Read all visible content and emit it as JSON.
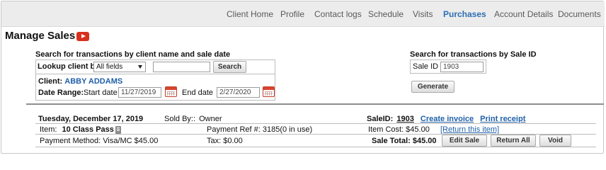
{
  "nav": {
    "items": [
      {
        "label": "Client Home",
        "active": false
      },
      {
        "label": "Profile",
        "active": false
      },
      {
        "label": "Contact logs",
        "active": false
      },
      {
        "label": "Schedule",
        "active": false
      },
      {
        "label": "Visits",
        "active": false
      },
      {
        "label": "Purchases",
        "active": true
      },
      {
        "label": "Account Details",
        "active": false
      },
      {
        "label": "Documents",
        "active": false
      }
    ],
    "active_color": "#2c6fb3"
  },
  "page": {
    "title": "Manage Sales",
    "video_icon": "youtube-play-icon"
  },
  "search": {
    "heading": "Search for transactions by client name and sale date",
    "lookup_label": "Lookup client by",
    "lookup_field_value": "All fields",
    "lookup_text_value": "",
    "search_button": "Search",
    "client_label": "Client:",
    "client_name": "ABBY ADDAMS",
    "date_range_label": "Date Range:",
    "start_label": "Start date",
    "start_value": "11/27/2019",
    "end_label": "End date",
    "end_value": "2/27/2020",
    "calendar_icon": "calendar-icon"
  },
  "saleid_search": {
    "heading": "Search for transactions by Sale ID",
    "label": "Sale ID",
    "value": "1903",
    "generate_button": "Generate"
  },
  "sale": {
    "date": "Tuesday, December 17, 2019",
    "sold_by_label": "Sold By::",
    "sold_by": "Owner",
    "saleid_label": "SaleID:",
    "saleid": "1903",
    "create_invoice": "Create invoice",
    "print_receipt": "Print receipt",
    "item_label": "Item:",
    "item_name": "10 Class Pass",
    "payment_ref": "Payment Ref #: 3185(0 in use)",
    "item_cost": "Item Cost: $45.00",
    "return_link": "[Return this item]",
    "payment_method": "Payment Method:  Visa/MC  $45.00",
    "tax": "Tax: $0.00",
    "sale_total": "Sale Total: $45.00",
    "edit_sale": "Edit Sale",
    "return_all": "Return All",
    "void": "Void"
  },
  "colors": {
    "link": "#1f5fa8",
    "brand_red": "#d7301f"
  }
}
